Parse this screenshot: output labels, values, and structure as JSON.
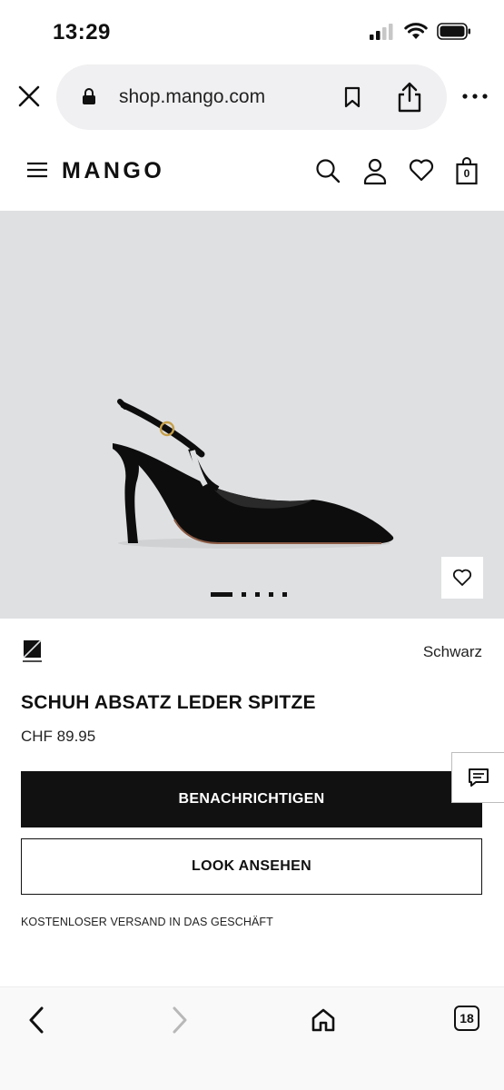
{
  "status_bar": {
    "time": "13:29"
  },
  "browser": {
    "url": "shop.mango.com"
  },
  "site": {
    "brand": "MANGO",
    "bag_count": "0"
  },
  "gallery": {
    "image_count": 5,
    "active_index": 0
  },
  "product": {
    "color_name": "Schwarz",
    "title": "SCHUH ABSATZ LEDER SPITZE",
    "price": "CHF 89.95"
  },
  "actions": {
    "notify_label": "BENACHRICHTIGEN",
    "look_label": "LOOK ANSEHEN"
  },
  "shipping_note": "KOSTENLOSER VERSAND IN DAS GESCHÄFT",
  "bottom_bar": {
    "tab_count": "18"
  },
  "icons": {
    "signal": "signal-icon",
    "wifi": "wifi-icon",
    "battery": "battery-icon",
    "close": "close-icon",
    "lock": "lock-icon",
    "bookmark": "bookmark-icon",
    "share": "share-icon",
    "more": "more-icon",
    "menu": "menu-icon",
    "search": "search-icon",
    "account": "user-icon",
    "wishlist": "heart-icon",
    "bag": "bag-icon",
    "chat": "chat-icon",
    "back": "chevron-left-icon",
    "forward": "chevron-right-icon",
    "home": "home-icon",
    "tabs": "tabs-icon"
  },
  "colors": {
    "primary": "#111111",
    "hero_bg": "#dfe0e2",
    "url_bar_bg": "#f0f0f2"
  }
}
